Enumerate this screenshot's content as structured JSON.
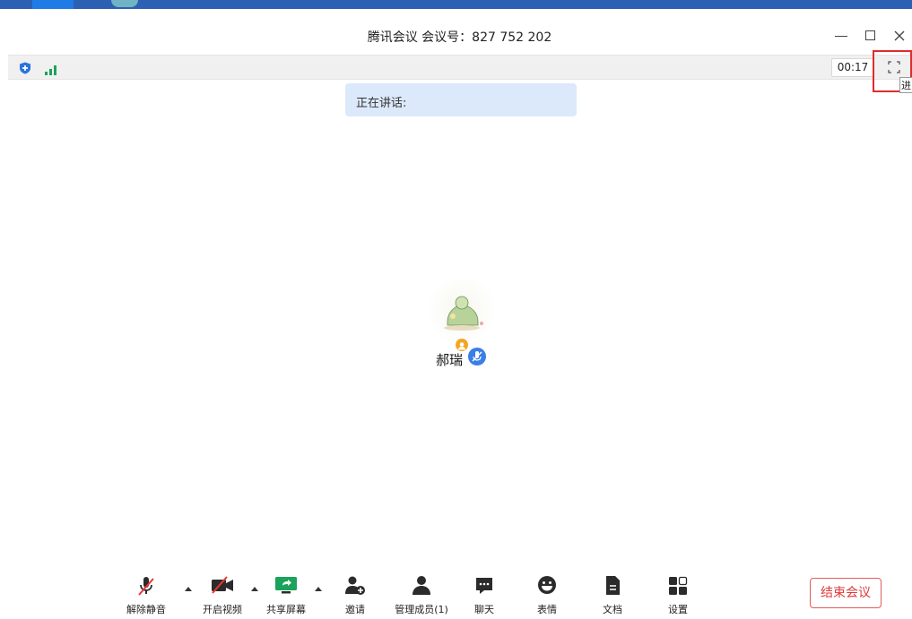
{
  "window": {
    "title": "腾讯会议 会议号：827 752 202",
    "minimize_icon": "minimize-icon",
    "maximize_icon": "maximize-icon",
    "close_icon": "close-icon"
  },
  "infobar": {
    "timer": "00:17",
    "fullscreen_tooltip": "进"
  },
  "speaking": {
    "label": "正在讲话:"
  },
  "participant": {
    "name": "郝瑞"
  },
  "toolbar": {
    "items": [
      {
        "label": "解除静音",
        "icon": "microphone-muted-icon"
      },
      {
        "label": "开启视频",
        "icon": "video-off-icon"
      },
      {
        "label": "共享屏幕",
        "icon": "share-screen-icon"
      },
      {
        "label": "邀请",
        "icon": "invite-icon"
      },
      {
        "label": "管理成员(1)",
        "icon": "members-icon"
      },
      {
        "label": "聊天",
        "icon": "chat-icon"
      },
      {
        "label": "表情",
        "icon": "emoji-icon"
      },
      {
        "label": "文档",
        "icon": "document-icon"
      },
      {
        "label": "设置",
        "icon": "settings-icon"
      }
    ],
    "end_label": "结束会议"
  },
  "colors": {
    "accent_blue": "#3a7ee6",
    "share_green": "#1aa35a",
    "end_red": "#e03a3a",
    "banner_blue": "#dbe9fb"
  }
}
